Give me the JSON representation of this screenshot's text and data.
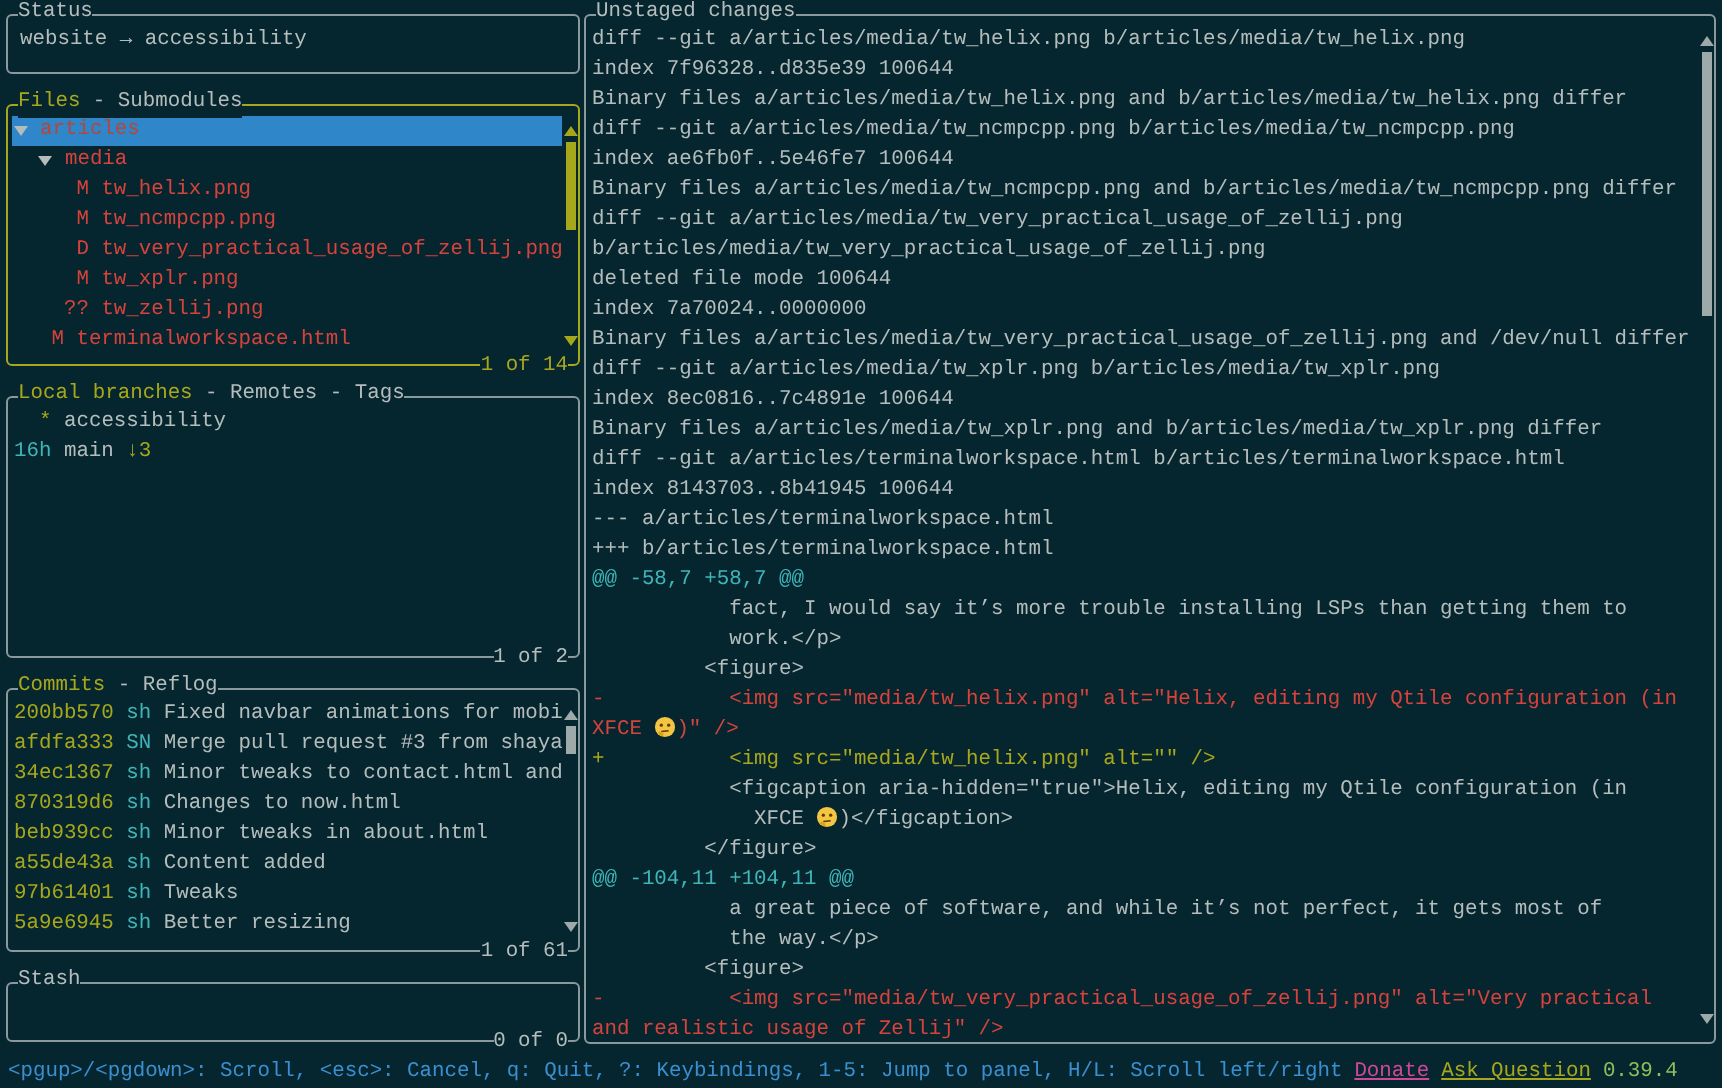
{
  "status_panel": {
    "title": "Status",
    "text": "website → accessibility"
  },
  "files_panel": {
    "focused": true,
    "tabs": [
      {
        "label": "Files",
        "selected": true
      },
      {
        "prefix": "-",
        "label": "Submodules",
        "selected": false
      }
    ],
    "counter": "1 of 14",
    "tree": [
      {
        "name": "articles",
        "expanded": true,
        "selected": true,
        "children": [
          {
            "name": "media",
            "expanded": true,
            "selected": false,
            "children": [
              {
                "name": "tw_helix.png",
                "status": "M",
                "selected": false
              },
              {
                "name": "tw_ncmpcpp.png",
                "status": "M",
                "selected": false
              },
              {
                "name": "tw_very_practical_usage_of_zellij.png",
                "status": "D",
                "selected": false
              },
              {
                "name": "tw_xplr.png",
                "status": "M",
                "selected": false
              },
              {
                "name": "tw_zellij.png",
                "status": "??",
                "selected": false
              }
            ]
          },
          {
            "name": "terminalworkspace.html",
            "status": "M",
            "selected": false
          }
        ]
      }
    ]
  },
  "branches_panel": {
    "focused": false,
    "tabs": [
      {
        "label": "Local branches",
        "selected": true
      },
      {
        "prefix": "-",
        "label": "Remotes",
        "selected": false
      },
      {
        "prefix": "-",
        "label": "Tags",
        "selected": false
      }
    ],
    "counter": "1 of 2",
    "branches": [
      {
        "marker": "*",
        "name": "accessibility"
      },
      {
        "age": "16h",
        "name": "main",
        "behind": "↓3"
      }
    ]
  },
  "commits_panel": {
    "focused": false,
    "tabs": [
      {
        "label": "Commits",
        "selected": true
      },
      {
        "prefix": "-",
        "label": "Reflog",
        "selected": false
      }
    ],
    "counter": "1 of 61",
    "commits": [
      {
        "hash": "200bb570",
        "author": "sh",
        "message": "Fixed navbar animations for mobi"
      },
      {
        "hash": "afdfa333",
        "author": "SN",
        "message": "Merge pull request #3 from shaya"
      },
      {
        "hash": "34ec1367",
        "author": "sh",
        "message": "Minor tweaks to contact.html and"
      },
      {
        "hash": "870319d6",
        "author": "sh",
        "message": "Changes to now.html"
      },
      {
        "hash": "beb939cc",
        "author": "sh",
        "message": "Minor tweaks in about.html"
      },
      {
        "hash": "a55de43a",
        "author": "sh",
        "message": "Content added"
      },
      {
        "hash": "97b61401",
        "author": "sh",
        "message": "Tweaks"
      },
      {
        "hash": "5a9e6945",
        "author": "sh",
        "message": "Better resizing"
      }
    ]
  },
  "stash_panel": {
    "title": "Stash",
    "counter": "0 of 0"
  },
  "diff_panel": {
    "title": "Unstaged changes",
    "lines": [
      {
        "kind": "header",
        "text": "diff --git a/articles/media/tw_helix.png b/articles/media/tw_helix.png"
      },
      {
        "kind": "header",
        "text": "index 7f96328..d835e39 100644"
      },
      {
        "kind": "header",
        "text": "Binary files a/articles/media/tw_helix.png and b/articles/media/tw_helix.png differ"
      },
      {
        "kind": "header",
        "text": "diff --git a/articles/media/tw_ncmpcpp.png b/articles/media/tw_ncmpcpp.png"
      },
      {
        "kind": "header",
        "text": "index ae6fb0f..5e46fe7 100644"
      },
      {
        "kind": "header",
        "text": "Binary files a/articles/media/tw_ncmpcpp.png and b/articles/media/tw_ncmpcpp.png differ"
      },
      {
        "kind": "header",
        "text": "diff --git a/articles/media/tw_very_practical_usage_of_zellij.png"
      },
      {
        "kind": "header",
        "text": "b/articles/media/tw_very_practical_usage_of_zellij.png"
      },
      {
        "kind": "header",
        "text": "deleted file mode 100644"
      },
      {
        "kind": "header",
        "text": "index 7a70024..0000000"
      },
      {
        "kind": "header",
        "text": "Binary files a/articles/media/tw_very_practical_usage_of_zellij.png and /dev/null differ"
      },
      {
        "kind": "header",
        "text": "diff --git a/articles/media/tw_xplr.png b/articles/media/tw_xplr.png"
      },
      {
        "kind": "header",
        "text": "index 8ec0816..7c4891e 100644"
      },
      {
        "kind": "header",
        "text": "Binary files a/articles/media/tw_xplr.png and b/articles/media/tw_xplr.png differ"
      },
      {
        "kind": "header",
        "text": "diff --git a/articles/terminalworkspace.html b/articles/terminalworkspace.html"
      },
      {
        "kind": "header",
        "text": "index 8143703..8b41945 100644"
      },
      {
        "kind": "header",
        "text": "--- a/articles/terminalworkspace.html"
      },
      {
        "kind": "header",
        "text": "+++ b/articles/terminalworkspace.html"
      },
      {
        "kind": "hunk",
        "text": "@@ -58,7 +58,7 @@"
      },
      {
        "kind": "context",
        "text": "           fact, I would say it’s more trouble installing LSPs than getting them to"
      },
      {
        "kind": "context",
        "text": "           work.</p>"
      },
      {
        "kind": "context",
        "text": "         <figure>"
      },
      {
        "kind": "removed",
        "text": "-          <img src=\"media/tw_helix.png\" alt=\"Helix, editing my Qtile configuration (in"
      },
      {
        "kind": "removed",
        "segments": [
          "XFCE ",
          ")\" />"
        ]
      },
      {
        "kind": "added",
        "text": "+          <img src=\"media/tw_helix.png\" alt=\"\" />"
      },
      {
        "kind": "context",
        "text": "           <figcaption aria-hidden=\"true\">Helix, editing my Qtile configuration (in"
      },
      {
        "kind": "context",
        "segments": [
          "             XFCE ",
          ")</figcaption>"
        ]
      },
      {
        "kind": "context",
        "text": "         </figure>"
      },
      {
        "kind": "hunk",
        "text": "@@ -104,11 +104,11 @@"
      },
      {
        "kind": "context",
        "text": "           a great piece of software, and while it’s not perfect, it gets most of"
      },
      {
        "kind": "context",
        "text": "           the way.</p>"
      },
      {
        "kind": "context",
        "text": "         <figure>"
      },
      {
        "kind": "removed",
        "text": "-          <img src=\"media/tw_very_practical_usage_of_zellij.png\" alt=\"Very practical"
      },
      {
        "kind": "removed",
        "text": "and realistic usage of Zellij\" />"
      }
    ]
  },
  "footer": {
    "keybindings": "<pgup>/<pgdown>: Scroll, <esc>: Cancel, q: Quit, ?: Keybindings, 1-5: Jump to panel, H/L: Scroll left/right",
    "donate": "Donate",
    "ask": "Ask Question",
    "version": "0.39.4"
  }
}
